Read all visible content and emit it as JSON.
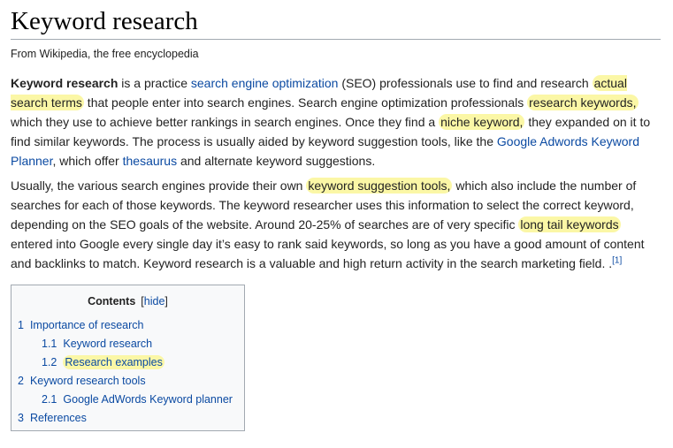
{
  "article": {
    "title": "Keyword research",
    "tagline": "From Wikipedia, the free encyclopedia"
  },
  "para1": {
    "term": "Keyword research",
    "t1": " is a practice ",
    "link_seo": "search engine optimization",
    "t2": " (SEO) professionals use to find and research ",
    "hl_actual": "actual search terms",
    "t3": " that people enter into search engines. Search engine optimization professionals ",
    "hl_research_keywords": "research keywords,",
    "t4": " which they use to achieve better rankings in search engines. Once they find a ",
    "hl_niche": "niche keyword,",
    "t5": " they expanded on it to find similar keywords. The process is usually aided by keyword suggestion tools, like the ",
    "link_planner": "Google Adwords Keyword Planner",
    "t6": ", which offer ",
    "link_thesaurus": "thesaurus",
    "t7": " and alternate keyword suggestions."
  },
  "para2": {
    "t1": "Usually, the various search engines provide their own ",
    "hl_tools": "keyword suggestion tools,",
    "t2": " which also include the number of searches for each of those keywords. The keyword researcher uses this information to select the correct keyword, depending on the SEO goals of the website. Around 20-25% of searches are of very specific ",
    "hl_long_tail": "long tail keywords",
    "t3": " entered into Google every single day it’s easy to rank said keywords, so long as you have a good amount of content and backlinks to match. Keyword research is a valuable and high return activity in the search marketing field. .",
    "ref": "[1]"
  },
  "toc": {
    "title": "Contents",
    "bracket_open": "[",
    "toggle": "hide",
    "bracket_close": "]",
    "items": [
      {
        "num": "1",
        "text": "Importance of research",
        "level": 1
      },
      {
        "num": "1.1",
        "text": "Keyword research",
        "level": 2
      },
      {
        "num": "1.2",
        "text": "Research examples",
        "level": 2
      },
      {
        "num": "2",
        "text": "Keyword research tools",
        "level": 1
      },
      {
        "num": "2.1",
        "text": "Google AdWords Keyword planner",
        "level": 2
      },
      {
        "num": "3",
        "text": "References",
        "level": 1
      }
    ]
  },
  "colors": {
    "link": "#0b4aa2",
    "highlight": "#fbf7a6",
    "toc_background": "#f8f9fa",
    "border": "#a2a9b1"
  }
}
